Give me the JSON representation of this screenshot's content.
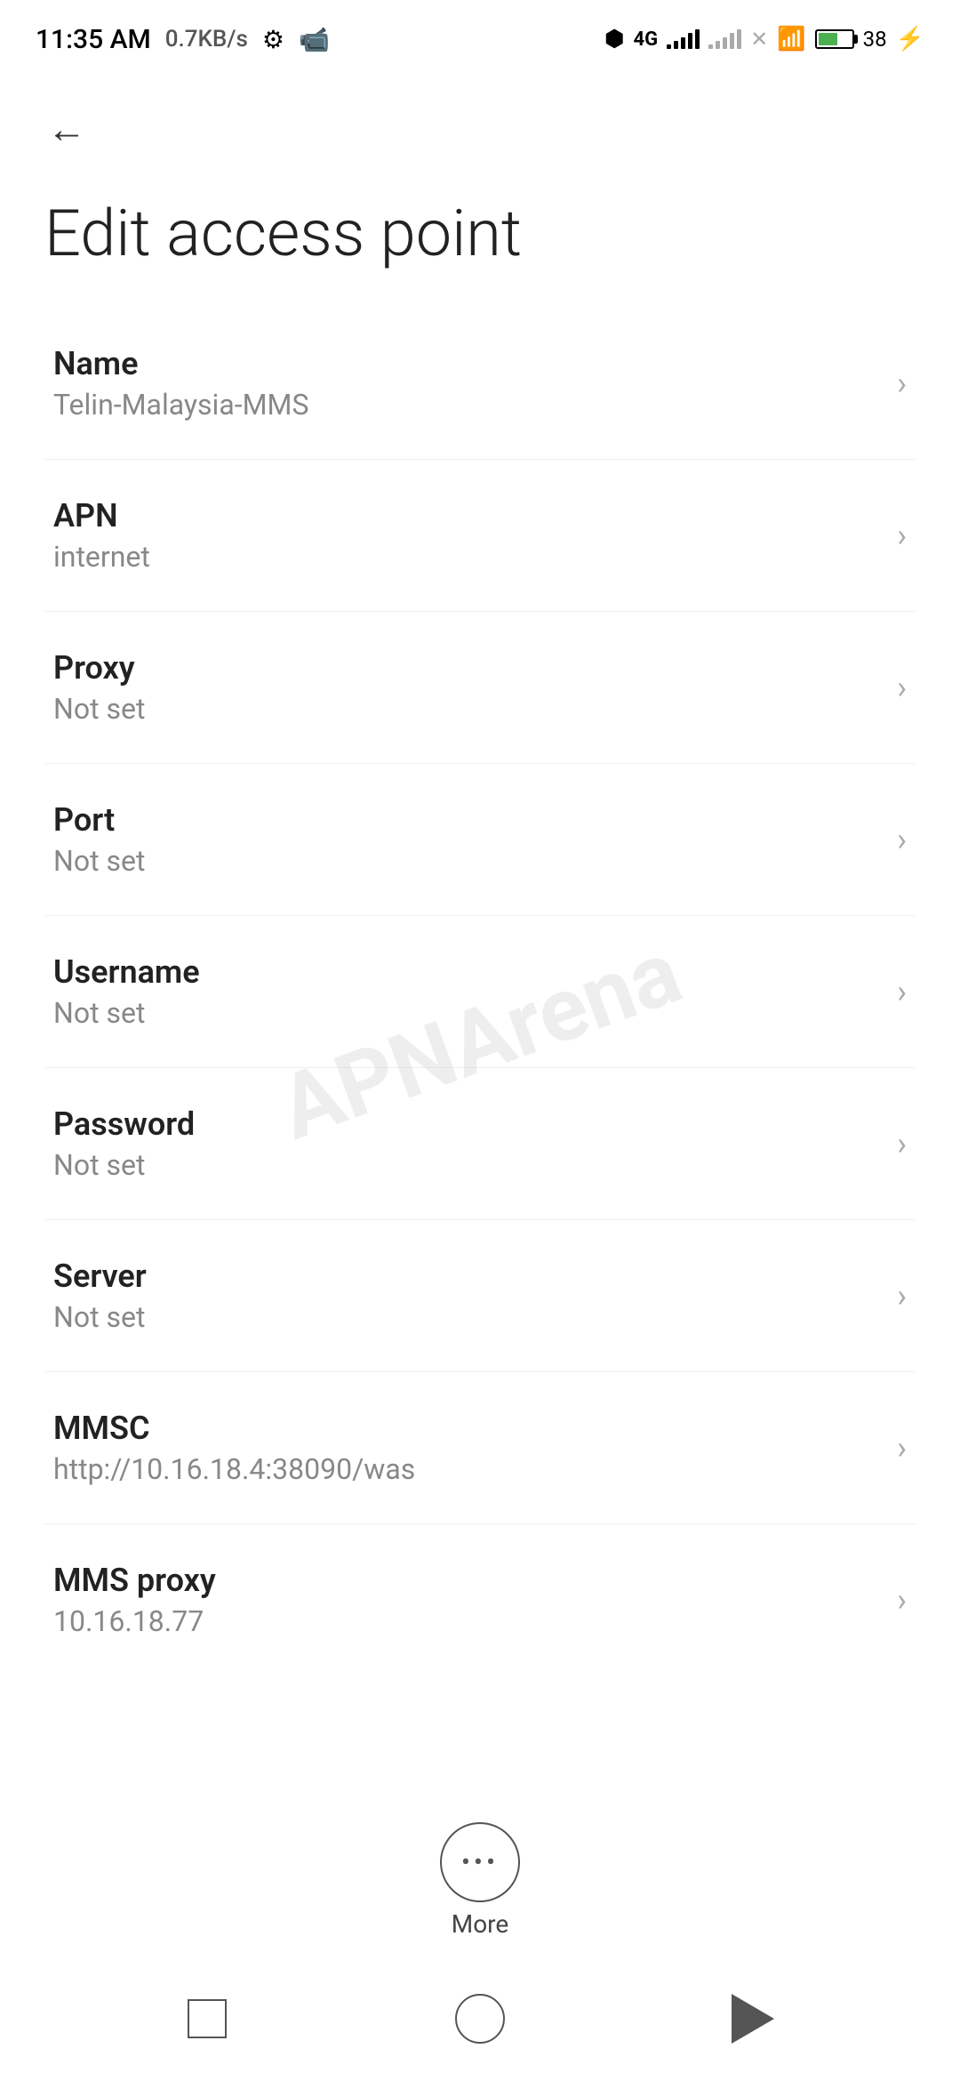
{
  "statusBar": {
    "time": "11:35 AM",
    "networkSpeed": "0.7KB/s"
  },
  "navigation": {
    "backLabel": "←"
  },
  "page": {
    "title": "Edit access point"
  },
  "settingsItems": [
    {
      "label": "Name",
      "value": "Telin-Malaysia-MMS"
    },
    {
      "label": "APN",
      "value": "internet"
    },
    {
      "label": "Proxy",
      "value": "Not set"
    },
    {
      "label": "Port",
      "value": "Not set"
    },
    {
      "label": "Username",
      "value": "Not set"
    },
    {
      "label": "Password",
      "value": "Not set"
    },
    {
      "label": "Server",
      "value": "Not set"
    },
    {
      "label": "MMSC",
      "value": "http://10.16.18.4:38090/was"
    },
    {
      "label": "MMS proxy",
      "value": "10.16.18.77"
    }
  ],
  "more": {
    "label": "More"
  },
  "bottomNav": {
    "square": "recent-apps",
    "circle": "home",
    "triangle": "back"
  }
}
